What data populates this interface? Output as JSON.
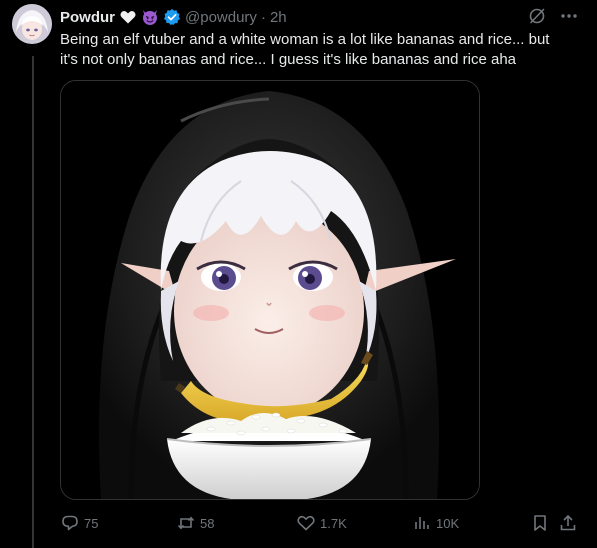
{
  "post": {
    "author": {
      "display_name": "Powdur",
      "emojis": [
        "white-heart-icon",
        "smiling-imp-icon"
      ],
      "verified": true,
      "handle": "@powdury",
      "separator": "·",
      "time": "2h"
    },
    "text_lines": [
      "Being an elf vtuber and a white woman is a lot like bananas and rice... but",
      "it's not only bananas and rice... I guess it's like bananas and rice aha"
    ],
    "media": {
      "icon": "vtuber-elf-image"
    },
    "actions": {
      "replies": "75",
      "reposts": "58",
      "likes": "1.7K",
      "views": "10K"
    }
  },
  "colors": {
    "background": "#000000",
    "text": "#e7e9ea",
    "muted": "#71767b",
    "verified": "#1d9bf0",
    "border": "#2f3336"
  }
}
